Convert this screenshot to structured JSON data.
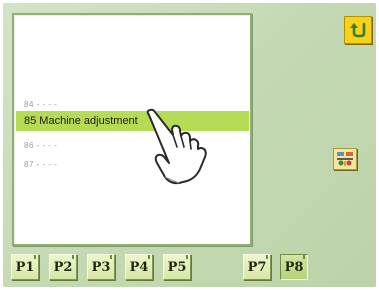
{
  "list": {
    "rows": [
      {
        "label": "84 - - - -"
      },
      {
        "label": "85 Machine adjustment"
      },
      {
        "label": "86 - - - -"
      },
      {
        "label": "87 - - - -"
      }
    ],
    "selected_index": 1
  },
  "pages": [
    {
      "label": "P1"
    },
    {
      "label": "P2"
    },
    {
      "label": "P3"
    },
    {
      "label": "P4"
    },
    {
      "label": "P5"
    },
    {
      "label": "P7"
    },
    {
      "label": "P8"
    }
  ],
  "active_page": "P8",
  "icons": {
    "return": "return-arrow-icon",
    "machine": "machine-adjust-icon",
    "pointer": "pointing-hand-icon"
  },
  "colors": {
    "background": "#c9ddba",
    "selection": "#b6dc55",
    "return_button": "#f6d21c"
  }
}
